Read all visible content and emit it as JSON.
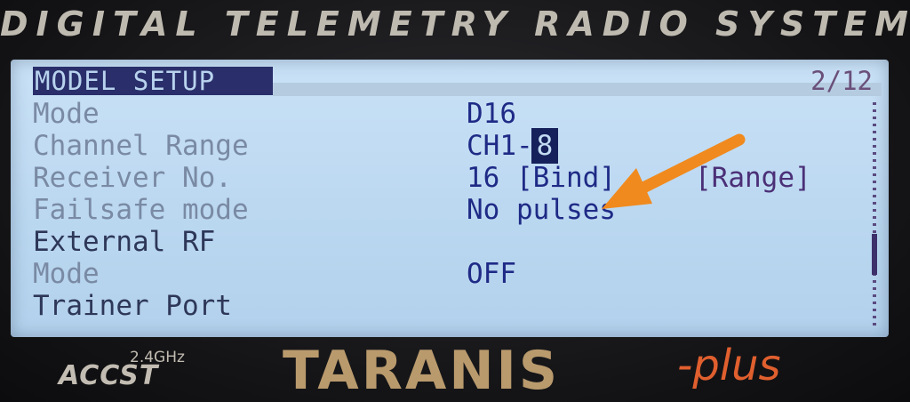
{
  "header": {
    "title": "DIGITAL TELEMETRY RADIO SYSTEM"
  },
  "screen": {
    "title": "MODEL SETUP",
    "page_indicator": "2/12",
    "rows": [
      {
        "label": "Mode",
        "value": "D16"
      },
      {
        "label": "Channel Range",
        "value_prefix": "CH1-",
        "value_cursor": "8"
      },
      {
        "label": "Receiver No.",
        "value": "16 [Bind]",
        "extra": "[Range]"
      },
      {
        "label": "Failsafe mode",
        "value": "No pulses"
      },
      {
        "label": "External RF"
      },
      {
        "label": "Mode",
        "value": "OFF"
      },
      {
        "label": "Trainer Port"
      }
    ]
  },
  "annotation": {
    "arrow_color": "#f08a1e"
  },
  "branding": {
    "freq": "2.4GHz",
    "protocol": "ACCST",
    "model": "TARANIS",
    "suffix": "-plus"
  },
  "colors": {
    "lcd_background": "#bad7f0",
    "lcd_text_dark": "#1f2a86",
    "label_gray": "#7a8aa4",
    "brand_gold": "#b99a6d",
    "brand_orange": "#e05f2e"
  }
}
